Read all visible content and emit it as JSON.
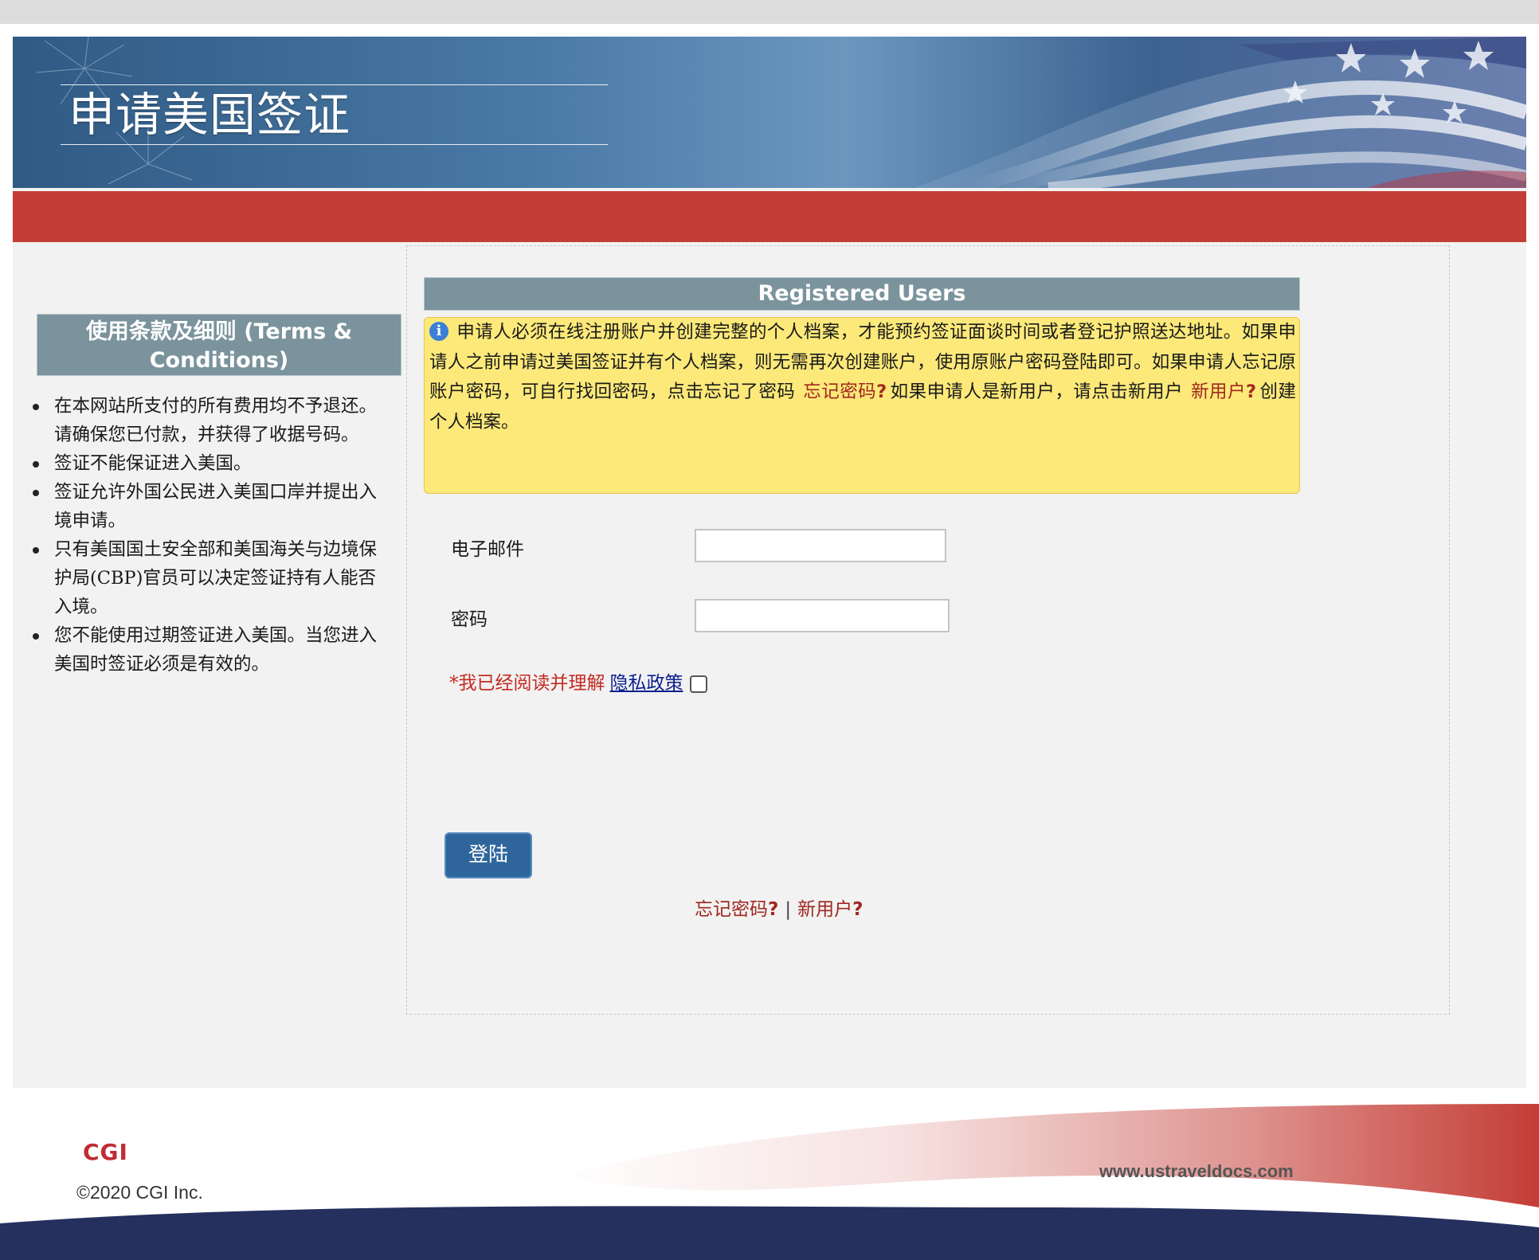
{
  "header": {
    "title": "申请美国签证"
  },
  "terms": {
    "heading": "使用条款及细则 (Terms & Conditions)",
    "items": [
      "在本网站所支付的所有费用均不予退还。请确保您已付款，并获得了收据号码。",
      "签证不能保证进入美国。",
      "签证允许外国公民进入美国口岸并提出入境申请。",
      "只有美国国土安全部和美国海关与边境保护局(CBP)官员可以决定签证持有人能否入境。",
      "您不能使用过期签证进入美国。当您进入美国时签证必须是有效的。"
    ]
  },
  "login": {
    "heading": "Registered Users",
    "notice": {
      "text_1": "申请人必须在线注册账户并创建完整的个人档案，才能预约签证面谈时间或者登记护照送达地址。如果申请人之前申请过美国签证并有个人档案，则无需再次创建账户，使用原账户密码登陆即可。如果申请人忘记原账户密码，可自行找回密码，点击忘记了密码",
      "forgot_link": "忘记密码",
      "text_2": "如果申请人是新用户，请点击新用户",
      "new_user_link": "新用户",
      "text_3": "创建个人档案。"
    },
    "email_label": "电子邮件",
    "email_value": "",
    "password_label": "密码",
    "password_value": "",
    "privacy_prefix": "*我已经阅读并理解",
    "privacy_link": "隐私政策",
    "privacy_checked": false,
    "submit_label": "登陆",
    "forgot_password": "忘记密码",
    "new_user": "新用户",
    "separator": "|",
    "question_mark": "?"
  },
  "footer": {
    "logo": "CGI",
    "copyright": "©2020 CGI Inc.",
    "url": "www.ustraveldocs.com"
  },
  "colors": {
    "header_bar": "#c43d36",
    "section_heading_bg": "#7a939c",
    "notice_bg": "#fce97a",
    "link_red": "#a0271f",
    "button_blue": "#2e669c",
    "footer_navy": "#26305e"
  }
}
